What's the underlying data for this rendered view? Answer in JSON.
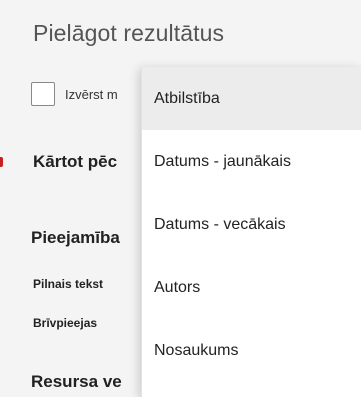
{
  "panel": {
    "title": "Pielāgot rezultātus",
    "expand_label": "Izvērst m"
  },
  "sort": {
    "label": "Kārtot pēc",
    "options": [
      {
        "label": "Atbilstība",
        "selected": true
      },
      {
        "label": "Datums - jaunākais",
        "selected": false
      },
      {
        "label": "Datums - vecākais",
        "selected": false
      },
      {
        "label": "Autors",
        "selected": false
      },
      {
        "label": "Nosaukums",
        "selected": false
      }
    ]
  },
  "availability": {
    "title": "Pieejamība",
    "items": [
      "Pilnais tekst",
      "Brīvpieejas"
    ]
  },
  "resource": {
    "title": "Resursa ve"
  },
  "colors": {
    "accent_red": "#c81e1e",
    "selected_bg": "#ececec",
    "panel_bg": "#f4f4f4"
  }
}
